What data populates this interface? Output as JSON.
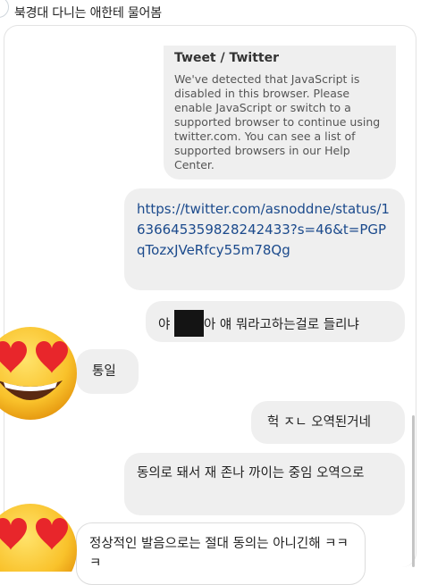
{
  "header": {
    "title": "북경대 다니는 애한테 물어봄"
  },
  "tweet_card": {
    "title": "Tweet / Twitter",
    "body": "We've detected that JavaScript is disabled in this browser. Please enable JavaScript or switch to a supported browser to continue using twitter.com. You can see a list of supported browsers in our Help Center."
  },
  "link_message": {
    "url": "https://twitter.com/asnoddne/status/1636645359828242433?s=46&t=PGPqTozxJVeRfcy55m78Qg"
  },
  "messages": [
    {
      "prefix": "야 ",
      "suffix": "아 얘 뭐라고하는걸로 들리냐",
      "sender": "me"
    },
    {
      "text": "통일",
      "sender": "them"
    },
    {
      "text": "헉 ㅈㄴ 오역된거네",
      "sender": "me"
    },
    {
      "text": "동의로 돼서 재 존나 까이는 중임 오역으로",
      "sender": "me"
    },
    {
      "text": "정상적인 발음으로는 절대 동의는 아니긴해 ㅋㅋㅋ",
      "sender": "them"
    }
  ],
  "emojis": [
    "heart-eyes-emoji",
    "heart-eyes-emoji"
  ]
}
